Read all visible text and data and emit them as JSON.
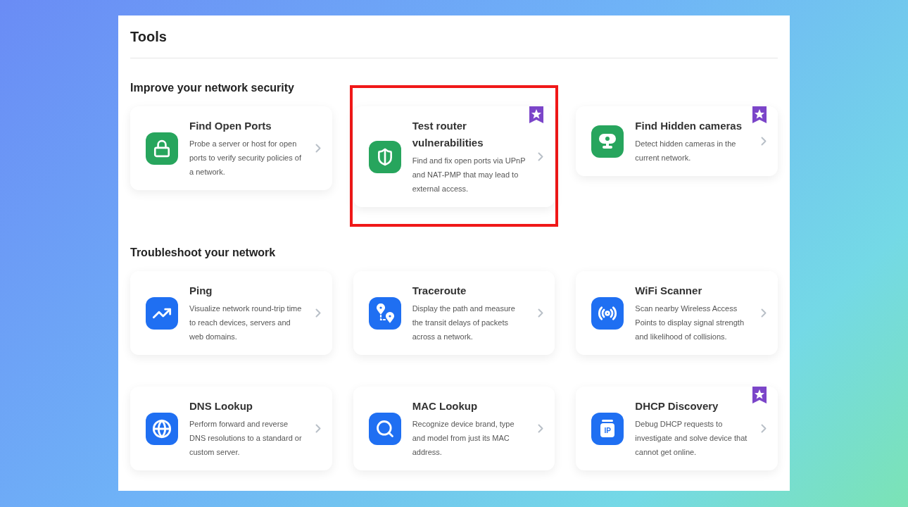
{
  "title": "Tools",
  "sections": [
    {
      "heading": "Improve your network security",
      "cards": [
        {
          "kind": "lock",
          "color": "#27a55d",
          "title": "Find Open Ports",
          "description": "Probe a server or host for open ports to verify security policies of a network.",
          "featured": false,
          "highlighted": false
        },
        {
          "kind": "shield",
          "color": "#27a55d",
          "title": "Test router vulnerabilities",
          "description": "Find and fix open ports via UPnP and NAT-PMP that may lead to external access.",
          "featured": true,
          "highlighted": true
        },
        {
          "kind": "camera",
          "color": "#27a55d",
          "title": "Find Hidden cameras",
          "description": "Detect hidden cameras in the current network.",
          "featured": true,
          "highlighted": false
        }
      ]
    },
    {
      "heading": "Troubleshoot your network",
      "cards": [
        {
          "kind": "trend",
          "color": "#1f6ff2",
          "title": "Ping",
          "description": "Visualize network round-trip time to reach devices, servers and web domains.",
          "featured": false,
          "highlighted": false
        },
        {
          "kind": "route",
          "color": "#1f6ff2",
          "title": "Traceroute",
          "description": "Display the path and measure the transit delays of packets across a network.",
          "featured": false,
          "highlighted": false
        },
        {
          "kind": "antenna",
          "color": "#1f6ff2",
          "title": "WiFi Scanner",
          "description": "Scan nearby Wireless Access Points to display signal strength and likelihood of collisions.",
          "featured": false,
          "highlighted": false
        },
        {
          "kind": "globe",
          "color": "#1f6ff2",
          "title": "DNS Lookup",
          "description": "Perform forward and reverse DNS resolutions to a standard or custom server.",
          "featured": false,
          "highlighted": false
        },
        {
          "kind": "search",
          "color": "#1f6ff2",
          "title": "MAC Lookup",
          "description": "Recognize device brand, type and model from just its MAC address.",
          "featured": false,
          "highlighted": false
        },
        {
          "kind": "ip",
          "icon_label": "IP",
          "color": "#1f6ff2",
          "title": "DHCP Discovery",
          "description": "Debug DHCP requests to investigate and solve device that cannot get online.",
          "featured": true,
          "highlighted": false
        }
      ]
    }
  ]
}
